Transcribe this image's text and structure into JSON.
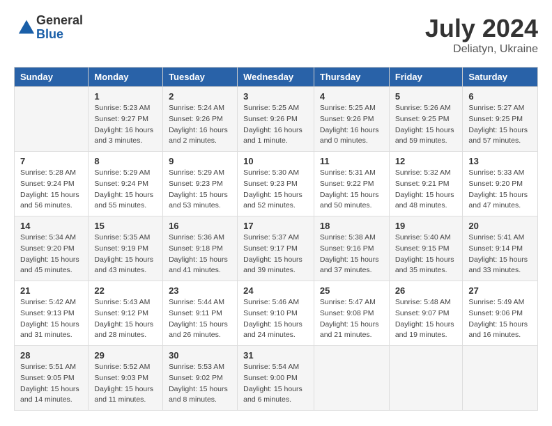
{
  "logo": {
    "general": "General",
    "blue": "Blue"
  },
  "title": {
    "month_year": "July 2024",
    "location": "Deliatyn, Ukraine"
  },
  "headers": [
    "Sunday",
    "Monday",
    "Tuesday",
    "Wednesday",
    "Thursday",
    "Friday",
    "Saturday"
  ],
  "weeks": [
    [
      {
        "num": "",
        "sunrise": "",
        "sunset": "",
        "daylight": ""
      },
      {
        "num": "1",
        "sunrise": "Sunrise: 5:23 AM",
        "sunset": "Sunset: 9:27 PM",
        "daylight": "Daylight: 16 hours and 3 minutes."
      },
      {
        "num": "2",
        "sunrise": "Sunrise: 5:24 AM",
        "sunset": "Sunset: 9:26 PM",
        "daylight": "Daylight: 16 hours and 2 minutes."
      },
      {
        "num": "3",
        "sunrise": "Sunrise: 5:25 AM",
        "sunset": "Sunset: 9:26 PM",
        "daylight": "Daylight: 16 hours and 1 minute."
      },
      {
        "num": "4",
        "sunrise": "Sunrise: 5:25 AM",
        "sunset": "Sunset: 9:26 PM",
        "daylight": "Daylight: 16 hours and 0 minutes."
      },
      {
        "num": "5",
        "sunrise": "Sunrise: 5:26 AM",
        "sunset": "Sunset: 9:25 PM",
        "daylight": "Daylight: 15 hours and 59 minutes."
      },
      {
        "num": "6",
        "sunrise": "Sunrise: 5:27 AM",
        "sunset": "Sunset: 9:25 PM",
        "daylight": "Daylight: 15 hours and 57 minutes."
      }
    ],
    [
      {
        "num": "7",
        "sunrise": "Sunrise: 5:28 AM",
        "sunset": "Sunset: 9:24 PM",
        "daylight": "Daylight: 15 hours and 56 minutes."
      },
      {
        "num": "8",
        "sunrise": "Sunrise: 5:29 AM",
        "sunset": "Sunset: 9:24 PM",
        "daylight": "Daylight: 15 hours and 55 minutes."
      },
      {
        "num": "9",
        "sunrise": "Sunrise: 5:29 AM",
        "sunset": "Sunset: 9:23 PM",
        "daylight": "Daylight: 15 hours and 53 minutes."
      },
      {
        "num": "10",
        "sunrise": "Sunrise: 5:30 AM",
        "sunset": "Sunset: 9:23 PM",
        "daylight": "Daylight: 15 hours and 52 minutes."
      },
      {
        "num": "11",
        "sunrise": "Sunrise: 5:31 AM",
        "sunset": "Sunset: 9:22 PM",
        "daylight": "Daylight: 15 hours and 50 minutes."
      },
      {
        "num": "12",
        "sunrise": "Sunrise: 5:32 AM",
        "sunset": "Sunset: 9:21 PM",
        "daylight": "Daylight: 15 hours and 48 minutes."
      },
      {
        "num": "13",
        "sunrise": "Sunrise: 5:33 AM",
        "sunset": "Sunset: 9:20 PM",
        "daylight": "Daylight: 15 hours and 47 minutes."
      }
    ],
    [
      {
        "num": "14",
        "sunrise": "Sunrise: 5:34 AM",
        "sunset": "Sunset: 9:20 PM",
        "daylight": "Daylight: 15 hours and 45 minutes."
      },
      {
        "num": "15",
        "sunrise": "Sunrise: 5:35 AM",
        "sunset": "Sunset: 9:19 PM",
        "daylight": "Daylight: 15 hours and 43 minutes."
      },
      {
        "num": "16",
        "sunrise": "Sunrise: 5:36 AM",
        "sunset": "Sunset: 9:18 PM",
        "daylight": "Daylight: 15 hours and 41 minutes."
      },
      {
        "num": "17",
        "sunrise": "Sunrise: 5:37 AM",
        "sunset": "Sunset: 9:17 PM",
        "daylight": "Daylight: 15 hours and 39 minutes."
      },
      {
        "num": "18",
        "sunrise": "Sunrise: 5:38 AM",
        "sunset": "Sunset: 9:16 PM",
        "daylight": "Daylight: 15 hours and 37 minutes."
      },
      {
        "num": "19",
        "sunrise": "Sunrise: 5:40 AM",
        "sunset": "Sunset: 9:15 PM",
        "daylight": "Daylight: 15 hours and 35 minutes."
      },
      {
        "num": "20",
        "sunrise": "Sunrise: 5:41 AM",
        "sunset": "Sunset: 9:14 PM",
        "daylight": "Daylight: 15 hours and 33 minutes."
      }
    ],
    [
      {
        "num": "21",
        "sunrise": "Sunrise: 5:42 AM",
        "sunset": "Sunset: 9:13 PM",
        "daylight": "Daylight: 15 hours and 31 minutes."
      },
      {
        "num": "22",
        "sunrise": "Sunrise: 5:43 AM",
        "sunset": "Sunset: 9:12 PM",
        "daylight": "Daylight: 15 hours and 28 minutes."
      },
      {
        "num": "23",
        "sunrise": "Sunrise: 5:44 AM",
        "sunset": "Sunset: 9:11 PM",
        "daylight": "Daylight: 15 hours and 26 minutes."
      },
      {
        "num": "24",
        "sunrise": "Sunrise: 5:46 AM",
        "sunset": "Sunset: 9:10 PM",
        "daylight": "Daylight: 15 hours and 24 minutes."
      },
      {
        "num": "25",
        "sunrise": "Sunrise: 5:47 AM",
        "sunset": "Sunset: 9:08 PM",
        "daylight": "Daylight: 15 hours and 21 minutes."
      },
      {
        "num": "26",
        "sunrise": "Sunrise: 5:48 AM",
        "sunset": "Sunset: 9:07 PM",
        "daylight": "Daylight: 15 hours and 19 minutes."
      },
      {
        "num": "27",
        "sunrise": "Sunrise: 5:49 AM",
        "sunset": "Sunset: 9:06 PM",
        "daylight": "Daylight: 15 hours and 16 minutes."
      }
    ],
    [
      {
        "num": "28",
        "sunrise": "Sunrise: 5:51 AM",
        "sunset": "Sunset: 9:05 PM",
        "daylight": "Daylight: 15 hours and 14 minutes."
      },
      {
        "num": "29",
        "sunrise": "Sunrise: 5:52 AM",
        "sunset": "Sunset: 9:03 PM",
        "daylight": "Daylight: 15 hours and 11 minutes."
      },
      {
        "num": "30",
        "sunrise": "Sunrise: 5:53 AM",
        "sunset": "Sunset: 9:02 PM",
        "daylight": "Daylight: 15 hours and 8 minutes."
      },
      {
        "num": "31",
        "sunrise": "Sunrise: 5:54 AM",
        "sunset": "Sunset: 9:00 PM",
        "daylight": "Daylight: 15 hours and 6 minutes."
      },
      {
        "num": "",
        "sunrise": "",
        "sunset": "",
        "daylight": ""
      },
      {
        "num": "",
        "sunrise": "",
        "sunset": "",
        "daylight": ""
      },
      {
        "num": "",
        "sunrise": "",
        "sunset": "",
        "daylight": ""
      }
    ]
  ]
}
